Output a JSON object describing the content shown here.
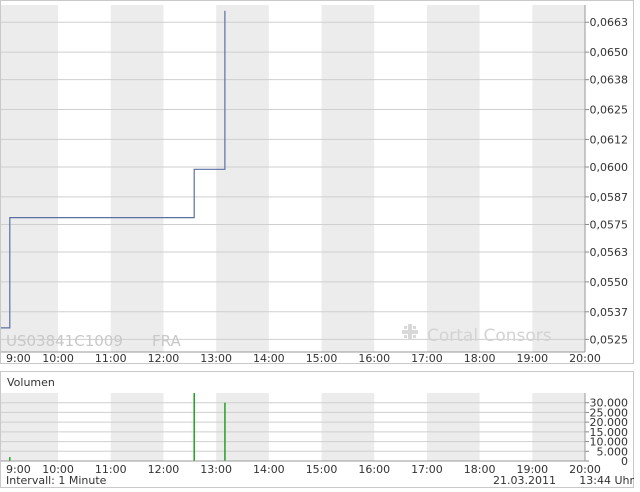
{
  "chart_data": [
    {
      "type": "line",
      "instrument": "US03841C1009",
      "exchange": "FRA",
      "brand": "Cortal Consors",
      "x_tick_labels": [
        "9:00",
        "10:00",
        "11:00",
        "12:00",
        "13:00",
        "14:00",
        "15:00",
        "16:00",
        "17:00",
        "18:00",
        "19:00",
        "20:00"
      ],
      "y_tick_labels": [
        "0,0525",
        "0,0537",
        "0,0550",
        "0,0563",
        "0,0575",
        "0,0587",
        "0,0600",
        "0,0612",
        "0,0625",
        "0,0638",
        "0,0650",
        "0,0663"
      ],
      "xlim": [
        "8:55",
        "20:00"
      ],
      "ylim": [
        0.05195,
        0.06705
      ],
      "grid": true,
      "series": [
        {
          "color": "#5b6fa0",
          "step": true,
          "points": [
            {
              "x": "8:55",
              "y": 0.053
            },
            {
              "x": "9:05",
              "y": 0.053
            },
            {
              "x": "9:05",
              "y": 0.0578
            },
            {
              "x": "12:35",
              "y": 0.0578
            },
            {
              "x": "12:35",
              "y": 0.0599
            },
            {
              "x": "13:10",
              "y": 0.0599
            },
            {
              "x": "13:10",
              "y": 0.0668
            }
          ]
        }
      ]
    },
    {
      "type": "bar",
      "title": "Volumen",
      "x_tick_labels": [
        "9:00",
        "10:00",
        "11:00",
        "12:00",
        "13:00",
        "14:00",
        "15:00",
        "16:00",
        "17:00",
        "18:00",
        "19:00",
        "20:00"
      ],
      "y_tick_labels": [
        "0",
        "5.000",
        "10.000",
        "15.000",
        "20.000",
        "25.000",
        "30.000"
      ],
      "ylim": [
        0,
        35000
      ],
      "color": "#22a022",
      "bars": [
        {
          "x": "9:05",
          "value": 2000
        },
        {
          "x": "12:35",
          "value": 35000
        },
        {
          "x": "13:10",
          "value": 30000
        }
      ]
    }
  ],
  "footer": {
    "interval": "Intervall: 1 Minute",
    "date": "21.03.2011",
    "time": "13:44 Uhr"
  }
}
